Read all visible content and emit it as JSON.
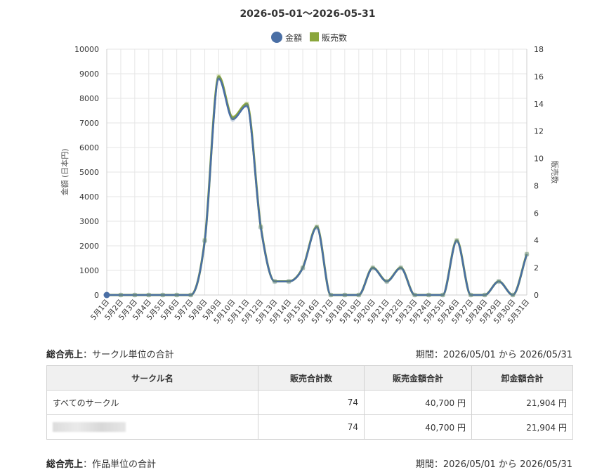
{
  "chart_data": {
    "type": "line",
    "title": "2026-05-01〜2026-05-31",
    "legend": {
      "position": "top-center",
      "items": [
        {
          "label": "金額",
          "color": "#4a6fa5",
          "marker": "circle"
        },
        {
          "label": "販売数",
          "color": "#8aa63c",
          "marker": "square"
        }
      ]
    },
    "ylabel": "金額 (日本円)",
    "y2label": "販売数",
    "ylim": [
      0,
      10000
    ],
    "y2lim": [
      0,
      18
    ],
    "yticks": [
      "0",
      "1000",
      "2000",
      "3000",
      "4000",
      "5000",
      "6000",
      "7000",
      "8000",
      "9000",
      "10000"
    ],
    "y2ticks": [
      "0",
      "2",
      "4",
      "6",
      "8",
      "10",
      "12",
      "14",
      "16",
      "18"
    ],
    "grid": true,
    "categories": [
      "5月1日",
      "5月2日",
      "5月3日",
      "5月4日",
      "5月5日",
      "5月6日",
      "5月7日",
      "5月8日",
      "5月9日",
      "5月10日",
      "5月11日",
      "5月12日",
      "5月13日",
      "5月14日",
      "5月15日",
      "5月16日",
      "5月17日",
      "5月18日",
      "5月19日",
      "5月20日",
      "5月21日",
      "5月22日",
      "5月23日",
      "5月24日",
      "5月25日",
      "5月26日",
      "5月27日",
      "5月28日",
      "5月29日",
      "5月30日",
      "5月31日"
    ],
    "series": [
      {
        "name": "金額",
        "axis": "left",
        "color": "#4a6fa5",
        "values": [
          0,
          0,
          0,
          0,
          0,
          0,
          0,
          2200,
          8800,
          7150,
          7700,
          2750,
          550,
          550,
          1100,
          2750,
          0,
          0,
          0,
          1100,
          550,
          1100,
          0,
          0,
          0,
          2200,
          0,
          0,
          550,
          0,
          1650
        ]
      },
      {
        "name": "販売数",
        "axis": "right",
        "color": "#8aa63c",
        "values": [
          0,
          0,
          0,
          0,
          0,
          0,
          0,
          4,
          16,
          13,
          14,
          5,
          1,
          1,
          2,
          5,
          0,
          0,
          0,
          2,
          1,
          2,
          0,
          0,
          0,
          4,
          0,
          0,
          1,
          0,
          3
        ]
      }
    ]
  },
  "summary_circle": {
    "title": "総合売上",
    "subtitle": "：サークル単位の合計",
    "period": "期間：2026/05/01 から 2026/05/31",
    "headers": [
      "サークル名",
      "販売合計数",
      "販売金額合計",
      "卸金額合計"
    ],
    "rows": [
      {
        "name": "すべてのサークル",
        "count": "74",
        "amount": "40,700 円",
        "wholesale": "21,904 円"
      },
      {
        "name": "",
        "count": "74",
        "amount": "40,700 円",
        "wholesale": "21,904 円"
      }
    ]
  },
  "summary_work": {
    "title": "総合売上",
    "subtitle": "：作品単位の合計",
    "period": "期間：2026/05/01 から 2026/05/31"
  }
}
